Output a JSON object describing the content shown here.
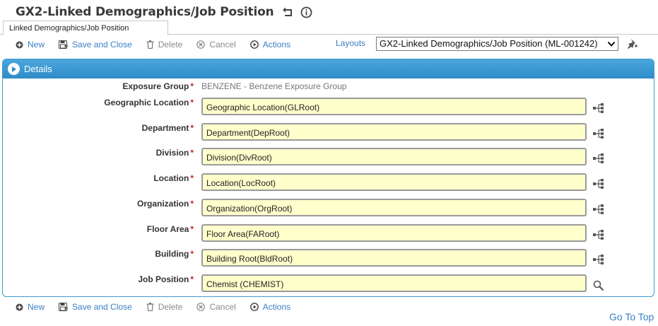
{
  "header": {
    "title": "GX2-Linked Demographics/Job Position",
    "tab_label": "Linked Demographics/Job Position"
  },
  "toolbar": {
    "new_label": "New",
    "save_close_label": "Save and Close",
    "delete_label": "Delete",
    "cancel_label": "Cancel",
    "actions_label": "Actions"
  },
  "layouts": {
    "label": "Layouts",
    "selected": "GX2-Linked Demographics/Job Position (ML-001242)"
  },
  "details": {
    "title": "Details",
    "required_mark": "*",
    "exposure_group": {
      "label": "Exposure Group",
      "value": "BENZENE - Benzene Exposure Group"
    },
    "fields": [
      {
        "label": "Geographic Location",
        "value": "Geographic Location(GLRoot)",
        "icon": "tree-icon"
      },
      {
        "label": "Department",
        "value": "Department(DepRoot)",
        "icon": "tree-icon"
      },
      {
        "label": "Division",
        "value": "Division(DivRoot)",
        "icon": "tree-icon"
      },
      {
        "label": "Location",
        "value": "Location(LocRoot)",
        "icon": "tree-icon"
      },
      {
        "label": "Organization",
        "value": "Organization(OrgRoot)",
        "icon": "tree-icon"
      },
      {
        "label": "Floor Area",
        "value": "Floor Area(FARoot)",
        "icon": "tree-icon"
      },
      {
        "label": "Building",
        "value": "Building Root(BldRoot)",
        "icon": "tree-icon"
      },
      {
        "label": "Job Position",
        "value": "Chemist (CHEMIST)",
        "icon": "search-icon"
      }
    ]
  },
  "footer": {
    "goto_top": "Go To Top"
  },
  "colors": {
    "accent": "#3a7fc4",
    "panel_header": "#3d9ad1",
    "field_bg": "#ffffcc",
    "required": "#d21f1f"
  }
}
